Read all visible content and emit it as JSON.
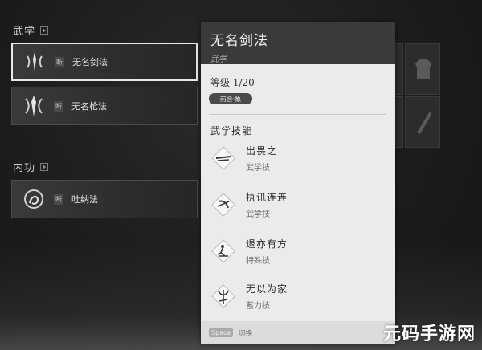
{
  "sections": {
    "martial": {
      "title": "武学"
    },
    "internal": {
      "title": "内功"
    }
  },
  "skills": [
    {
      "tag": "断",
      "label": "无名剑法",
      "emblem": "sword-emblem-icon"
    },
    {
      "tag": "断",
      "label": "无名枪法",
      "emblem": "spear-emblem-icon"
    }
  ],
  "internal_skills": [
    {
      "tag": "断",
      "label": "吐纳法",
      "emblem": "breathing-emblem-icon"
    }
  ],
  "detail": {
    "title": "无名剑法",
    "subtitle": "武学",
    "level": "等级 1/20",
    "stage": "前合·象",
    "abilities_heading": "武学技能",
    "abilities": [
      {
        "name": "出畏之",
        "type": "武学技",
        "icon": "slash-icon"
      },
      {
        "name": "执讯连连",
        "type": "武学技",
        "icon": "combo-icon"
      },
      {
        "name": "退亦有方",
        "type": "特殊技",
        "icon": "retreat-icon"
      },
      {
        "name": "无以为家",
        "type": "蓄力技",
        "icon": "charge-icon"
      }
    ],
    "footer": {
      "key": "Space",
      "action": "切换"
    }
  },
  "watermark": "元码手游网",
  "colors": {
    "background": "#1d1d1f",
    "panel": "#ebebea",
    "panel_header": "#3a3a3c",
    "selected_border": "#e8e8e8"
  }
}
